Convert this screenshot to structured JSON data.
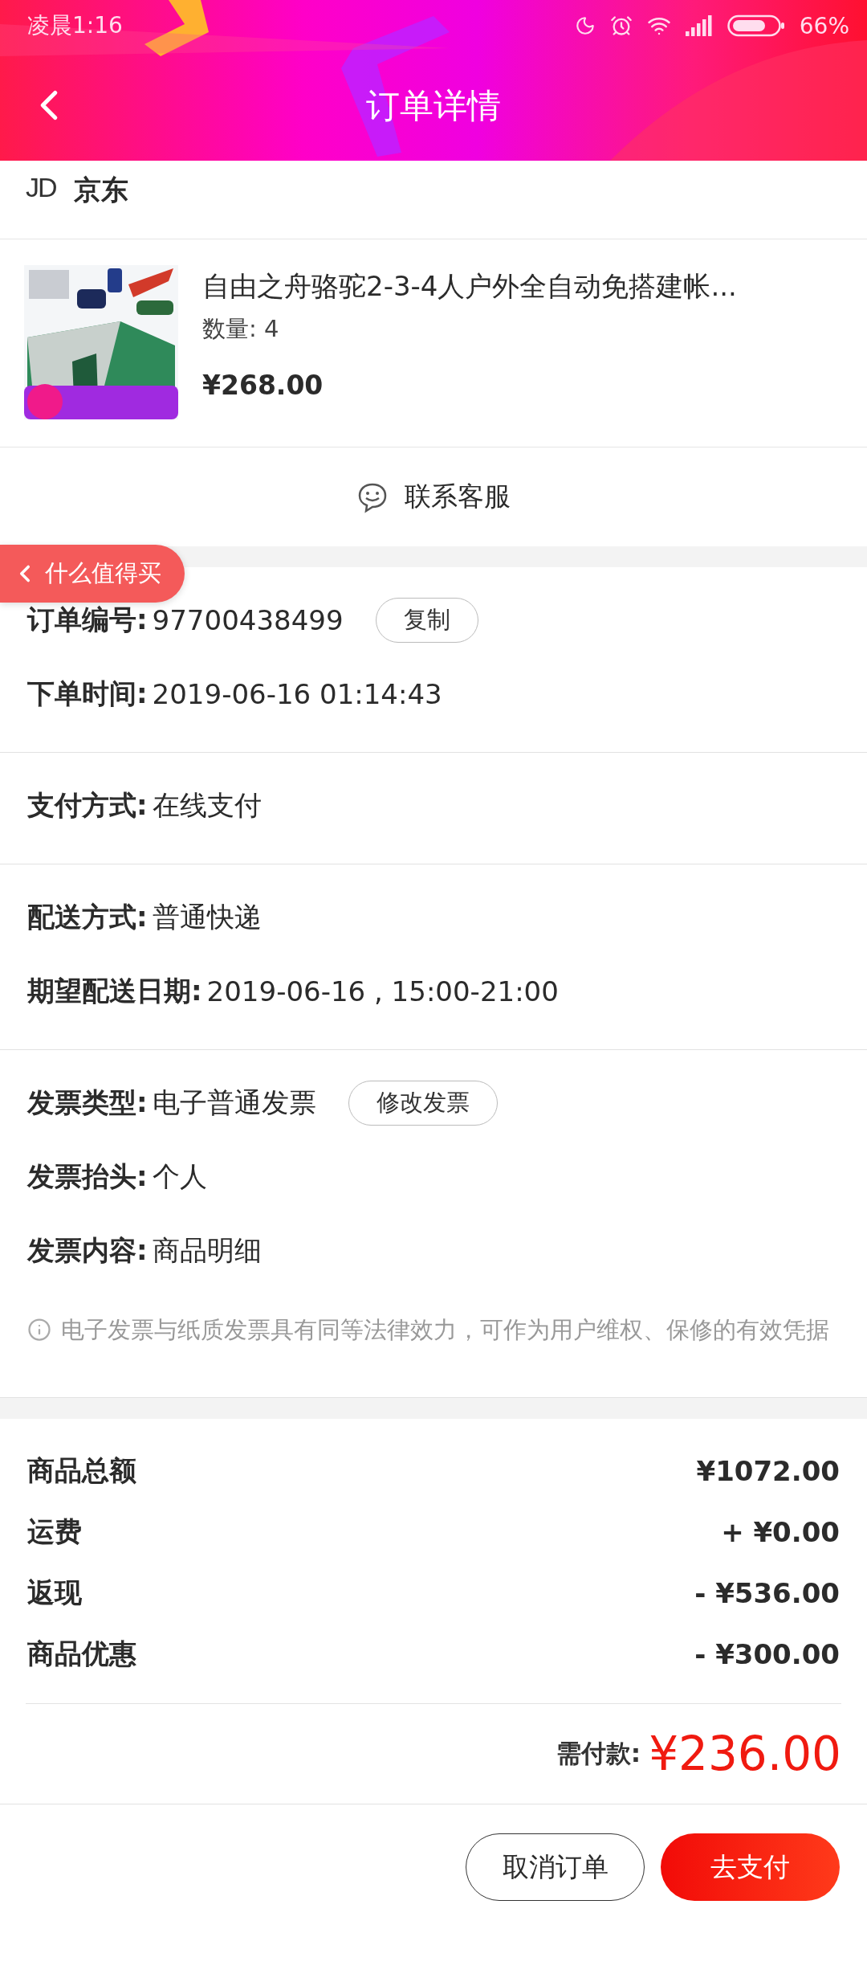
{
  "status_bar": {
    "time": "凌晨1:16",
    "battery": "66%"
  },
  "header": {
    "title": "订单详情"
  },
  "shop": {
    "logo": "JD",
    "name": "京东"
  },
  "product": {
    "title": "自由之舟骆驼2-3-4人户外全自动免搭建帐...",
    "quantity": "数量: 4",
    "price": "¥268.00"
  },
  "contact": {
    "label": "联系客服"
  },
  "floating_tab": {
    "label": "什么值得买"
  },
  "info_sections": [
    {
      "rows": [
        {
          "label": "订单编号:",
          "value": "97700438499",
          "button": "复制"
        },
        {
          "label": "下单时间:",
          "value": "2019-06-16 01:14:43"
        }
      ]
    },
    {
      "rows": [
        {
          "label": "支付方式:",
          "value": "在线支付"
        }
      ]
    },
    {
      "rows": [
        {
          "label": "配送方式:",
          "value": "普通快递"
        },
        {
          "label": "期望配送日期:",
          "value": "2019-06-16 , 15:00-21:00"
        }
      ]
    },
    {
      "rows": [
        {
          "label": "发票类型:",
          "value": "电子普通发票",
          "button": "修改发票"
        },
        {
          "label": "发票抬头:",
          "value": "个人"
        },
        {
          "label": "发票内容:",
          "value": "商品明细"
        }
      ],
      "note": "电子发票与纸质发票具有同等法律效力，可作为用户维权、保修的有效凭据"
    }
  ],
  "summary": {
    "rows": [
      {
        "label": "商品总额",
        "value": "¥1072.00"
      },
      {
        "label": "运费",
        "value": "+ ¥0.00"
      },
      {
        "label": "返现",
        "value": "- ¥536.00"
      },
      {
        "label": "商品优惠",
        "value": "- ¥300.00"
      }
    ],
    "total_label": "需付款:",
    "total": "¥236.00"
  },
  "actions": [
    {
      "label": "取消订单",
      "kind": "secondary"
    },
    {
      "label": "去支付",
      "kind": "primary"
    }
  ]
}
